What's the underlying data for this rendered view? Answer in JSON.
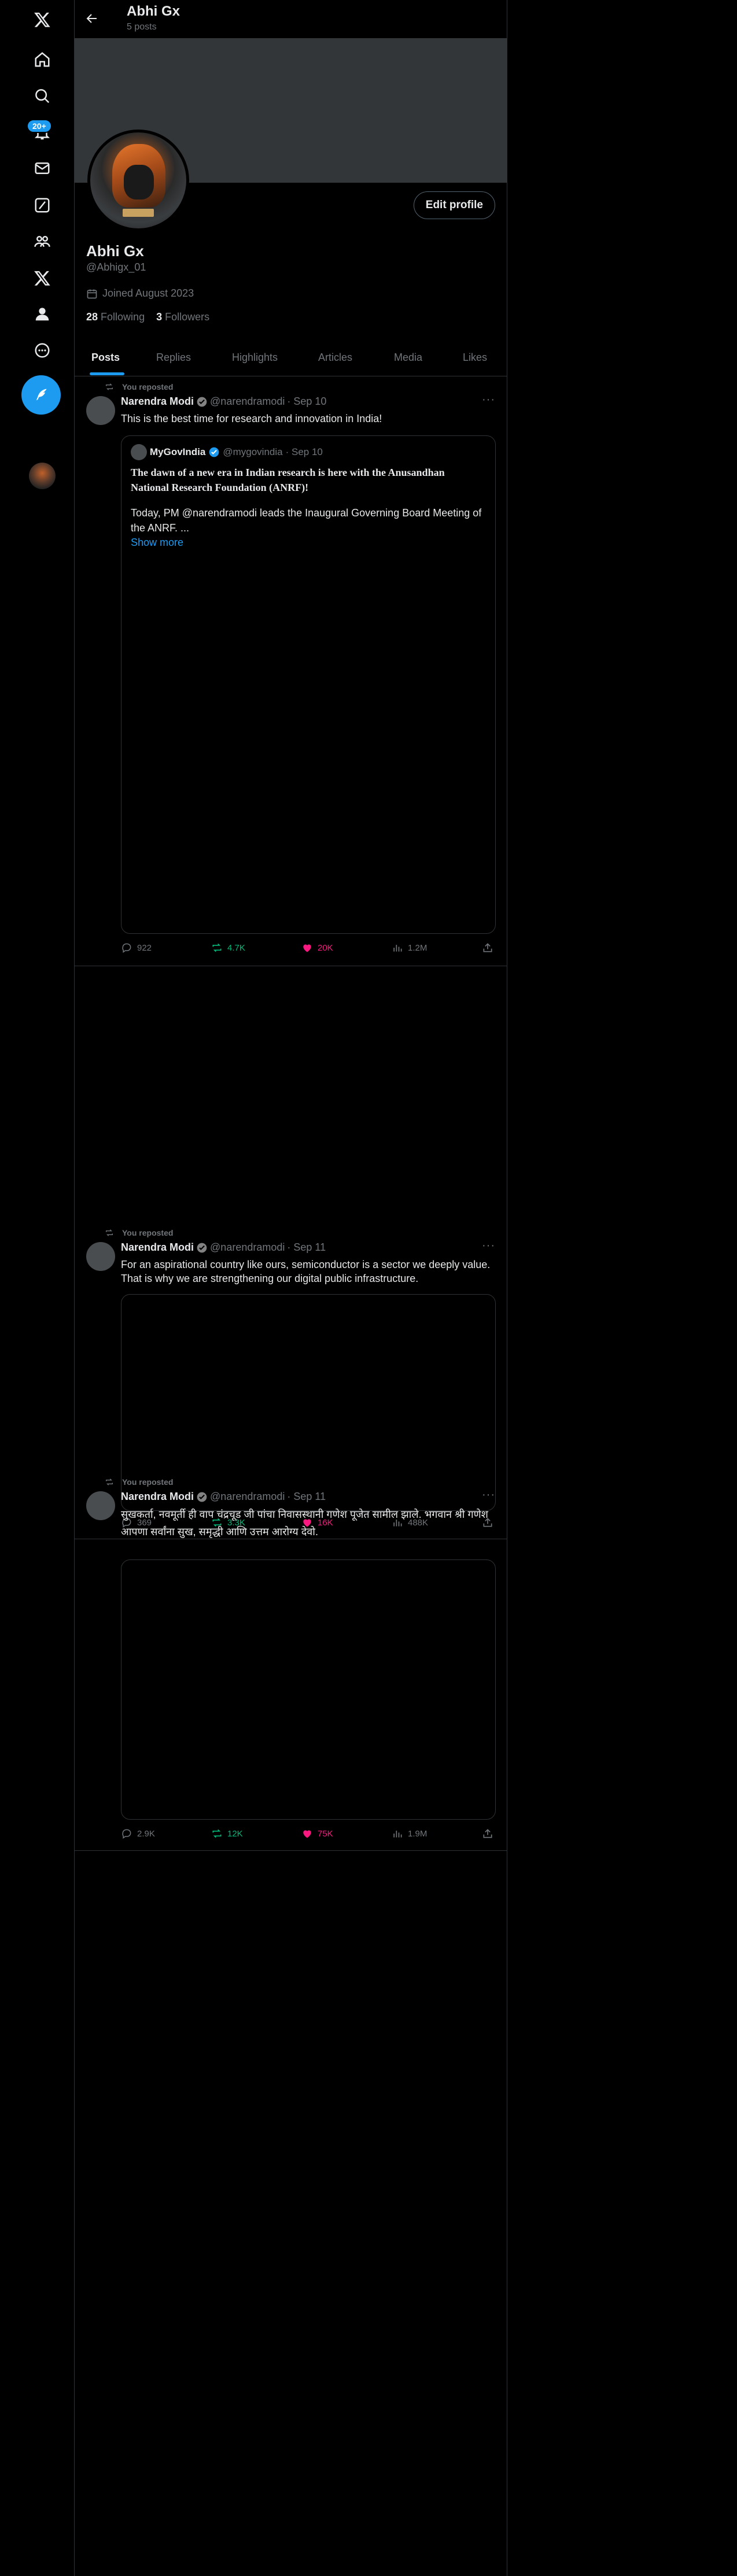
{
  "nav": {
    "notifications_badge": "20+",
    "icons": [
      "x-logo-icon",
      "home-icon",
      "search-icon",
      "bell-icon",
      "mail-icon",
      "grok-icon",
      "communities-icon",
      "x-premium-icon",
      "profile-icon",
      "more-icon"
    ]
  },
  "header": {
    "name": "Abhi Gx",
    "post_count": "5 posts"
  },
  "profile": {
    "name": "Abhi Gx",
    "handle": "@Abhigx_01",
    "joined": "Joined August 2023",
    "following_count": "28",
    "following_label": "Following",
    "followers_count": "3",
    "followers_label": "Followers",
    "edit_label": "Edit profile"
  },
  "tabs": [
    "Posts",
    "Replies",
    "Highlights",
    "Articles",
    "Media",
    "Likes"
  ],
  "tweets": [
    {
      "repost_label": "You reposted",
      "author": "Narendra Modi",
      "handle": "@narendramodi",
      "date": "· Sep 10",
      "text": "This is the best time for research and innovation in India!",
      "quote": {
        "author": "MyGovIndia",
        "handle": "@mygovindia",
        "date": "· Sep 10",
        "title": "The dawn of a new era in Indian research is here with the Anusandhan National Research Foundation (ANRF)!",
        "body": "Today, PM @narendramodi leads the Inaugural Governing Board Meeting of the ANRF. ...",
        "show_more": "Show more"
      },
      "replies": "922",
      "reposts": "4.7K",
      "likes": "20K",
      "views": "1.2M"
    },
    {
      "repost_label": "You reposted",
      "author": "Narendra Modi",
      "handle": "@narendramodi",
      "date": "· Sep 11",
      "text": "For an aspirational country like ours, semiconductor is a sector we deeply value. That is why we are strengthening our digital public infrastructure.",
      "replies": "369",
      "reposts": "3.3K",
      "likes": "16K",
      "views": "488K"
    },
    {
      "repost_label": "You reposted",
      "author": "Narendra Modi",
      "handle": "@narendramodi",
      "date": "· Sep 11",
      "text": "सुखकर्ता, नवमूर्ती ही वाप चंद्रचूड जी पांचा निवासस्थानी गणेश पूजेत सामील झाले. भगवान श्री गणेश आपणा सर्वांना सुख, समृद्धी आणि उत्तम आरोग्य देवो.",
      "replies": "2.9K",
      "reposts": "12K",
      "likes": "75K",
      "views": "1.9M"
    }
  ],
  "colors": {
    "accent": "#1d9bf0",
    "repost": "#00ba7c",
    "like": "#f91880",
    "muted": "#71767b"
  }
}
